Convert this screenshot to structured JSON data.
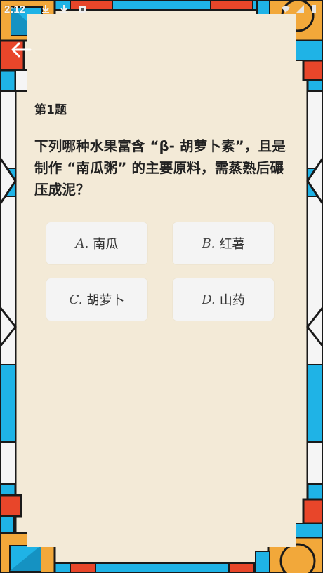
{
  "status_bar": {
    "time": "2:12",
    "icons": [
      "download-icon",
      "download-icon",
      "app-icon",
      "wifi-icon",
      "signal-icon",
      "battery-icon"
    ]
  },
  "nav": {
    "back_icon": "back-arrow-icon"
  },
  "question": {
    "number_label": "第1题",
    "text": "下列哪种水果富含 “β- 胡萝卜素”，且是制作 “南瓜粥” 的主要原料，需蒸熟后碾压成泥？"
  },
  "options": [
    {
      "letter": "A.",
      "text": "南瓜"
    },
    {
      "letter": "B.",
      "text": "红薯"
    },
    {
      "letter": "C.",
      "text": "胡萝卜"
    },
    {
      "letter": "D.",
      "text": "山药"
    }
  ],
  "theme": {
    "background": "#f3ead7",
    "accent_blue": "#1fb3e6",
    "accent_orange": "#f2a83a",
    "accent_red": "#e8462a",
    "option_bg": "#f4f4f4"
  }
}
